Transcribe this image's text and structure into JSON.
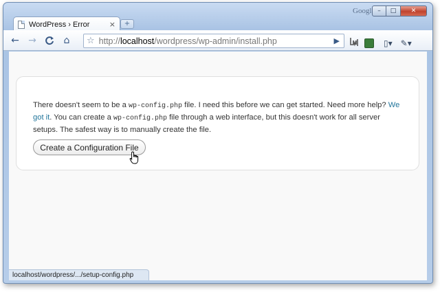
{
  "browser": {
    "tab_title": "WordPress › Error",
    "tab_close": "×",
    "new_tab": "+",
    "branding": "Google",
    "controls": {
      "minimize": "–",
      "maximize": "□",
      "close": "✕"
    }
  },
  "toolbar": {
    "back": "←",
    "forward": "→",
    "reload": "C",
    "home": "⌂",
    "star": "☆",
    "url_scheme": "http://",
    "url_host": "localhost",
    "url_path": "/wordpress/wp-admin/install.php",
    "go": "▶",
    "page_menu": "▯▾",
    "wrench_menu": "✎▾"
  },
  "main": {
    "message_part1": "There doesn't seem to be a ",
    "code1": "wp-config.php",
    "message_part2": " file. I need this before we can get started. Need more help? ",
    "help_link": "We got it",
    "message_part3": ". You can create a ",
    "code2": "wp-config.php",
    "message_part4": " file through a web interface, but this doesn't work for all server setups. The safest way is to manually create the file.",
    "button_label": "Create a Configuration File"
  },
  "status": {
    "hover_url": "localhost/wordpress/.../setup-config.php"
  },
  "colors": {
    "link": "#21759b",
    "frame": "#b6cde9"
  }
}
